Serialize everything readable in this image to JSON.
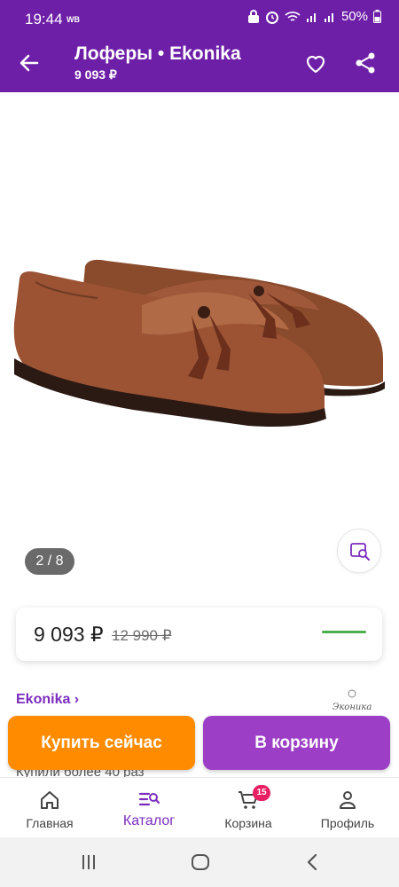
{
  "status_bar": {
    "time": "19:44",
    "extra": "WB",
    "battery": "50%"
  },
  "app_bar": {
    "title": "Лоферы • Ekonika",
    "subtitle": "9 093 ₽"
  },
  "gallery": {
    "counter": "2 / 8"
  },
  "price": {
    "current": "9 093 ₽",
    "old": "12 990 ₽"
  },
  "brand": {
    "link": "Ekonika ›",
    "logo_text": "Эконика"
  },
  "purchases": "Купили более 40 раз",
  "actions": {
    "buy_now": "Купить сейчас",
    "add_to_cart": "В корзину"
  },
  "bottom_nav": {
    "items": [
      {
        "label": "Главная",
        "icon": "home-icon"
      },
      {
        "label": "Каталог",
        "icon": "catalog-search-icon",
        "active": true
      },
      {
        "label": "Корзина",
        "icon": "cart-icon",
        "badge": "15"
      },
      {
        "label": "Профиль",
        "icon": "profile-icon"
      }
    ]
  },
  "colors": {
    "brand_purple": "#6e1fa8",
    "buy_orange": "#ff8c00",
    "cart_purple": "#9c3fc6",
    "badge_pink": "#e91e63"
  }
}
